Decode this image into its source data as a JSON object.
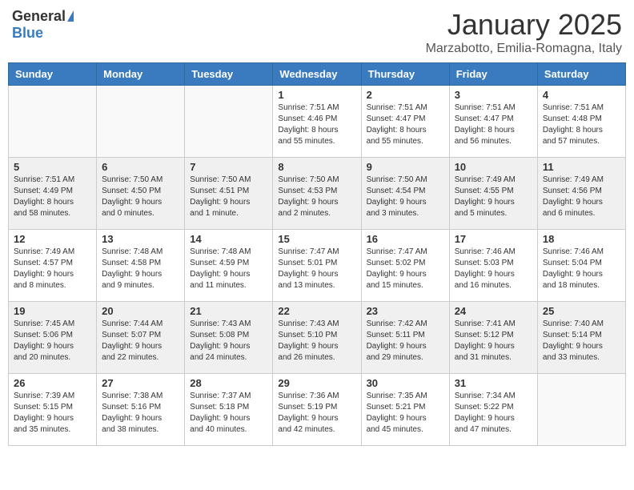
{
  "header": {
    "logo_general": "General",
    "logo_blue": "Blue",
    "month_title": "January 2025",
    "location": "Marzabotto, Emilia-Romagna, Italy"
  },
  "days_of_week": [
    "Sunday",
    "Monday",
    "Tuesday",
    "Wednesday",
    "Thursday",
    "Friday",
    "Saturday"
  ],
  "weeks": [
    {
      "days": [
        {
          "number": "",
          "info": ""
        },
        {
          "number": "",
          "info": ""
        },
        {
          "number": "",
          "info": ""
        },
        {
          "number": "1",
          "info": "Sunrise: 7:51 AM\nSunset: 4:46 PM\nDaylight: 8 hours\nand 55 minutes."
        },
        {
          "number": "2",
          "info": "Sunrise: 7:51 AM\nSunset: 4:47 PM\nDaylight: 8 hours\nand 55 minutes."
        },
        {
          "number": "3",
          "info": "Sunrise: 7:51 AM\nSunset: 4:47 PM\nDaylight: 8 hours\nand 56 minutes."
        },
        {
          "number": "4",
          "info": "Sunrise: 7:51 AM\nSunset: 4:48 PM\nDaylight: 8 hours\nand 57 minutes."
        }
      ],
      "shaded": false
    },
    {
      "days": [
        {
          "number": "5",
          "info": "Sunrise: 7:51 AM\nSunset: 4:49 PM\nDaylight: 8 hours\nand 58 minutes."
        },
        {
          "number": "6",
          "info": "Sunrise: 7:50 AM\nSunset: 4:50 PM\nDaylight: 9 hours\nand 0 minutes."
        },
        {
          "number": "7",
          "info": "Sunrise: 7:50 AM\nSunset: 4:51 PM\nDaylight: 9 hours\nand 1 minute."
        },
        {
          "number": "8",
          "info": "Sunrise: 7:50 AM\nSunset: 4:53 PM\nDaylight: 9 hours\nand 2 minutes."
        },
        {
          "number": "9",
          "info": "Sunrise: 7:50 AM\nSunset: 4:54 PM\nDaylight: 9 hours\nand 3 minutes."
        },
        {
          "number": "10",
          "info": "Sunrise: 7:49 AM\nSunset: 4:55 PM\nDaylight: 9 hours\nand 5 minutes."
        },
        {
          "number": "11",
          "info": "Sunrise: 7:49 AM\nSunset: 4:56 PM\nDaylight: 9 hours\nand 6 minutes."
        }
      ],
      "shaded": true
    },
    {
      "days": [
        {
          "number": "12",
          "info": "Sunrise: 7:49 AM\nSunset: 4:57 PM\nDaylight: 9 hours\nand 8 minutes."
        },
        {
          "number": "13",
          "info": "Sunrise: 7:48 AM\nSunset: 4:58 PM\nDaylight: 9 hours\nand 9 minutes."
        },
        {
          "number": "14",
          "info": "Sunrise: 7:48 AM\nSunset: 4:59 PM\nDaylight: 9 hours\nand 11 minutes."
        },
        {
          "number": "15",
          "info": "Sunrise: 7:47 AM\nSunset: 5:01 PM\nDaylight: 9 hours\nand 13 minutes."
        },
        {
          "number": "16",
          "info": "Sunrise: 7:47 AM\nSunset: 5:02 PM\nDaylight: 9 hours\nand 15 minutes."
        },
        {
          "number": "17",
          "info": "Sunrise: 7:46 AM\nSunset: 5:03 PM\nDaylight: 9 hours\nand 16 minutes."
        },
        {
          "number": "18",
          "info": "Sunrise: 7:46 AM\nSunset: 5:04 PM\nDaylight: 9 hours\nand 18 minutes."
        }
      ],
      "shaded": false
    },
    {
      "days": [
        {
          "number": "19",
          "info": "Sunrise: 7:45 AM\nSunset: 5:06 PM\nDaylight: 9 hours\nand 20 minutes."
        },
        {
          "number": "20",
          "info": "Sunrise: 7:44 AM\nSunset: 5:07 PM\nDaylight: 9 hours\nand 22 minutes."
        },
        {
          "number": "21",
          "info": "Sunrise: 7:43 AM\nSunset: 5:08 PM\nDaylight: 9 hours\nand 24 minutes."
        },
        {
          "number": "22",
          "info": "Sunrise: 7:43 AM\nSunset: 5:10 PM\nDaylight: 9 hours\nand 26 minutes."
        },
        {
          "number": "23",
          "info": "Sunrise: 7:42 AM\nSunset: 5:11 PM\nDaylight: 9 hours\nand 29 minutes."
        },
        {
          "number": "24",
          "info": "Sunrise: 7:41 AM\nSunset: 5:12 PM\nDaylight: 9 hours\nand 31 minutes."
        },
        {
          "number": "25",
          "info": "Sunrise: 7:40 AM\nSunset: 5:14 PM\nDaylight: 9 hours\nand 33 minutes."
        }
      ],
      "shaded": true
    },
    {
      "days": [
        {
          "number": "26",
          "info": "Sunrise: 7:39 AM\nSunset: 5:15 PM\nDaylight: 9 hours\nand 35 minutes."
        },
        {
          "number": "27",
          "info": "Sunrise: 7:38 AM\nSunset: 5:16 PM\nDaylight: 9 hours\nand 38 minutes."
        },
        {
          "number": "28",
          "info": "Sunrise: 7:37 AM\nSunset: 5:18 PM\nDaylight: 9 hours\nand 40 minutes."
        },
        {
          "number": "29",
          "info": "Sunrise: 7:36 AM\nSunset: 5:19 PM\nDaylight: 9 hours\nand 42 minutes."
        },
        {
          "number": "30",
          "info": "Sunrise: 7:35 AM\nSunset: 5:21 PM\nDaylight: 9 hours\nand 45 minutes."
        },
        {
          "number": "31",
          "info": "Sunrise: 7:34 AM\nSunset: 5:22 PM\nDaylight: 9 hours\nand 47 minutes."
        },
        {
          "number": "",
          "info": ""
        }
      ],
      "shaded": false
    }
  ]
}
